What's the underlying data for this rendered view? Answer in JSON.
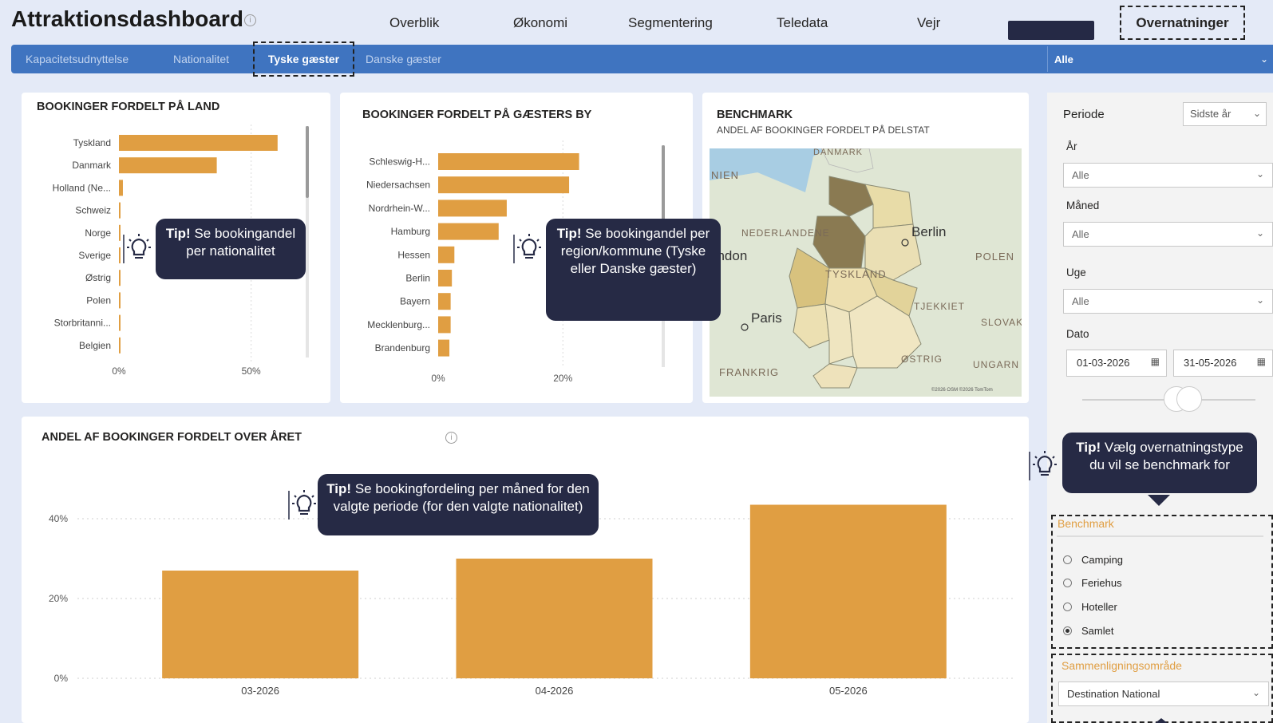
{
  "app": {
    "title": "Attraktionsdashboard"
  },
  "topnav": [
    "Overblik",
    "Økonomi",
    "Segmentering",
    "Teledata",
    "Vejr",
    "Overnatninger"
  ],
  "subtabs": [
    "Kapacitetsudnyttelse",
    "Nationalitet",
    "Tyske gæster",
    "Danske gæster"
  ],
  "nationality_filter": {
    "value": "Alle"
  },
  "tips": {
    "t1": {
      "bold": "Tip!",
      "text": " Se bookingandel per nationalitet"
    },
    "t2": {
      "bold": "Tip!",
      "text": " Se bookingandel per region/kommune (Tyske eller Danske gæster)"
    },
    "t3": {
      "bold": "Tip!",
      "text": " Se bookingfordeling per måned for den valgte periode (for den valgte nationalitet)"
    },
    "t4": {
      "bold": "Tip!",
      "text": " Vælg overnatningstype du vil se benchmark for"
    }
  },
  "benchmark_card": {
    "title": "BENCHMARK",
    "subtitle": "ANDEL AF BOOKINGER FORDELT PÅ DELSTAT",
    "map_labels": [
      "DANMARK",
      "NIEN",
      "NEDERLANDENE",
      "Berlin",
      "ondon",
      "POLEN",
      "TYSKLAND",
      "TJEKKIET",
      "Paris",
      "SLOVAK",
      "ØSTRIG",
      "UNGARN",
      "FRANKRIG"
    ],
    "attribution": "©2026 OSM ©2026 TomTom"
  },
  "filters": {
    "periode_label": "Periode",
    "periode_value": "Sidste år",
    "aar_label": "År",
    "aar_value": "Alle",
    "maaned_label": "Måned",
    "maaned_value": "Alle",
    "uge_label": "Uge",
    "uge_value": "Alle",
    "dato_label": "Dato",
    "dato_from": "01-03-2026",
    "dato_to": "31-05-2026",
    "benchmark_label": "Benchmark",
    "benchmark_options": [
      "Camping",
      "Feriehus",
      "Hoteller",
      "Samlet"
    ],
    "benchmark_selected": "Samlet",
    "omraade_label": "Sammenligningsområde",
    "omraade_value": "Destination National"
  },
  "chart_data": [
    {
      "type": "bar",
      "orientation": "horizontal",
      "title": "BOOKINGER FORDELT PÅ LAND",
      "categories": [
        "Tyskland",
        "Danmark",
        "Holland (Ne...",
        "Schweiz",
        "Norge",
        "Sverige",
        "Østrig",
        "Polen",
        "Storbritanni...",
        "Belgien"
      ],
      "values": [
        60,
        37,
        1.5,
        0.6,
        0.5,
        0.5,
        0.4,
        0.4,
        0.3,
        0.3
      ],
      "xticks": [
        "0%",
        "50%"
      ],
      "xlim": [
        0,
        67
      ],
      "color": "#e09e42"
    },
    {
      "type": "bar",
      "orientation": "horizontal",
      "title": "BOOKINGER FORDELT PÅ GÆSTERS BY",
      "categories": [
        "Schleswig-H...",
        "Niedersachsen",
        "Nordrhein-W...",
        "Hamburg",
        "Hessen",
        "Berlin",
        "Bayern",
        "Mecklenburg...",
        "Brandenburg"
      ],
      "values": [
        22.6,
        21,
        11,
        9.7,
        2.6,
        2.2,
        2,
        2,
        1.8
      ],
      "xticks": [
        "0%",
        "20%"
      ],
      "xlim": [
        0,
        32
      ],
      "color": "#e09e42"
    },
    {
      "type": "bar",
      "title": "ANDEL AF BOOKINGER FORDELT OVER ÅRET",
      "categories": [
        "03-2026",
        "04-2026",
        "05-2026"
      ],
      "values": [
        27,
        30,
        43.5
      ],
      "yticks": [
        "0%",
        "20%",
        "40%"
      ],
      "ylim": [
        0,
        46
      ],
      "grid": true,
      "color": "#e09e42"
    }
  ]
}
